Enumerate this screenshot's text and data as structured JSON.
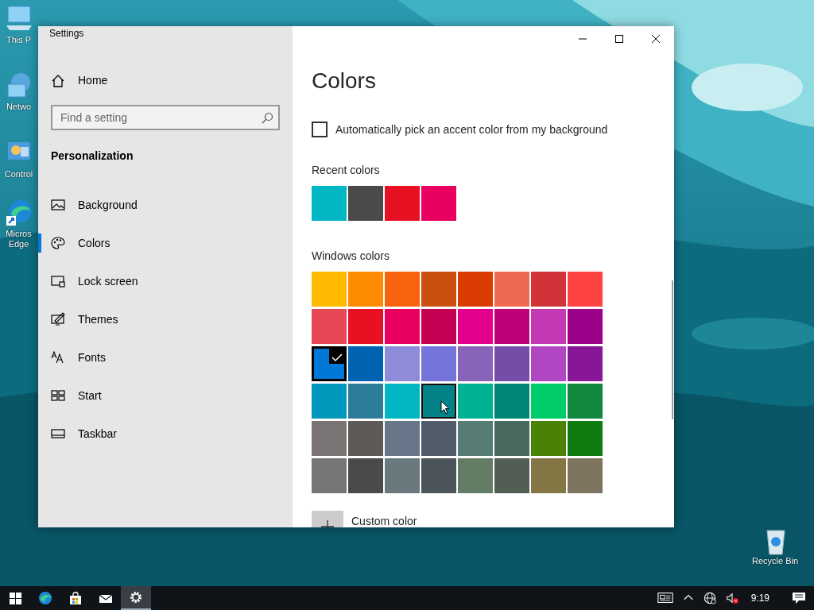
{
  "desktop_icons": [
    {
      "label": "This P"
    },
    {
      "label": "Netwo"
    },
    {
      "label": "Control"
    },
    {
      "label": "Micros Edge"
    },
    {
      "label": "Recycle Bin"
    }
  ],
  "window": {
    "title": "Settings",
    "sidebar": {
      "home": "Home",
      "search": {
        "placeholder": "Find a setting"
      },
      "section": "Personalization",
      "items": [
        {
          "label": "Background",
          "selected": false
        },
        {
          "label": "Colors",
          "selected": true
        },
        {
          "label": "Lock screen",
          "selected": false
        },
        {
          "label": "Themes",
          "selected": false
        },
        {
          "label": "Fonts",
          "selected": false
        },
        {
          "label": "Start",
          "selected": false
        },
        {
          "label": "Taskbar",
          "selected": false
        }
      ]
    },
    "content": {
      "heading": "Colors",
      "auto_accent": {
        "label": "Automatically pick an accent color from my background",
        "checked": false
      },
      "recent": {
        "label": "Recent colors",
        "swatches": [
          {
            "color": "#00b7c3"
          },
          {
            "color": "#4c4a48"
          },
          {
            "color": "#e81123"
          },
          {
            "color": "#ea005e"
          }
        ]
      },
      "windows": {
        "label": "Windows colors",
        "swatches": [
          {
            "color": "#ffb900",
            "selected": false,
            "hovered": false
          },
          {
            "color": "#ff8c00",
            "selected": false,
            "hovered": false
          },
          {
            "color": "#f7630c",
            "selected": false,
            "hovered": false
          },
          {
            "color": "#ca5010",
            "selected": false,
            "hovered": false
          },
          {
            "color": "#da3b01",
            "selected": false,
            "hovered": false
          },
          {
            "color": "#ef6950",
            "selected": false,
            "hovered": false
          },
          {
            "color": "#d13438",
            "selected": false,
            "hovered": false
          },
          {
            "color": "#ff4343",
            "selected": false,
            "hovered": false
          },
          {
            "color": "#e74856",
            "selected": false,
            "hovered": false
          },
          {
            "color": "#e81123",
            "selected": false,
            "hovered": false
          },
          {
            "color": "#ea005e",
            "selected": false,
            "hovered": false
          },
          {
            "color": "#c30052",
            "selected": false,
            "hovered": false
          },
          {
            "color": "#e3008c",
            "selected": false,
            "hovered": false
          },
          {
            "color": "#bf0077",
            "selected": false,
            "hovered": false
          },
          {
            "color": "#c239b3",
            "selected": false,
            "hovered": false
          },
          {
            "color": "#9a0089",
            "selected": false,
            "hovered": false
          },
          {
            "color": "#0078d7",
            "selected": true,
            "hovered": false
          },
          {
            "color": "#0063b1",
            "selected": false,
            "hovered": false
          },
          {
            "color": "#8e8cd8",
            "selected": false,
            "hovered": false
          },
          {
            "color": "#7474db",
            "selected": false,
            "hovered": false
          },
          {
            "color": "#8764b8",
            "selected": false,
            "hovered": false
          },
          {
            "color": "#744da9",
            "selected": false,
            "hovered": false
          },
          {
            "color": "#b146c2",
            "selected": false,
            "hovered": false
          },
          {
            "color": "#881798",
            "selected": false,
            "hovered": false
          },
          {
            "color": "#0099bc",
            "selected": false,
            "hovered": false
          },
          {
            "color": "#2d7d9a",
            "selected": false,
            "hovered": false
          },
          {
            "color": "#00b7c3",
            "selected": false,
            "hovered": false
          },
          {
            "color": "#038387",
            "selected": false,
            "hovered": true
          },
          {
            "color": "#00b294",
            "selected": false,
            "hovered": false
          },
          {
            "color": "#018574",
            "selected": false,
            "hovered": false
          },
          {
            "color": "#00cc6a",
            "selected": false,
            "hovered": false
          },
          {
            "color": "#10893e",
            "selected": false,
            "hovered": false
          },
          {
            "color": "#7a7574",
            "selected": false,
            "hovered": false
          },
          {
            "color": "#5d5a58",
            "selected": false,
            "hovered": false
          },
          {
            "color": "#68768a",
            "selected": false,
            "hovered": false
          },
          {
            "color": "#515c6b",
            "selected": false,
            "hovered": false
          },
          {
            "color": "#567c73",
            "selected": false,
            "hovered": false
          },
          {
            "color": "#486860",
            "selected": false,
            "hovered": false
          },
          {
            "color": "#498205",
            "selected": false,
            "hovered": false
          },
          {
            "color": "#107c10",
            "selected": false,
            "hovered": false
          },
          {
            "color": "#767676",
            "selected": false,
            "hovered": false
          },
          {
            "color": "#4c4a48",
            "selected": false,
            "hovered": false
          },
          {
            "color": "#69797e",
            "selected": false,
            "hovered": false
          },
          {
            "color": "#4a5459",
            "selected": false,
            "hovered": false
          },
          {
            "color": "#647c64",
            "selected": false,
            "hovered": false
          },
          {
            "color": "#525e54",
            "selected": false,
            "hovered": false
          },
          {
            "color": "#847545",
            "selected": false,
            "hovered": false
          },
          {
            "color": "#7e735f",
            "selected": false,
            "hovered": false
          }
        ]
      },
      "custom": {
        "label": "Custom color"
      }
    }
  },
  "taskbar": {
    "apps": [
      {
        "selected": false
      },
      {
        "selected": false
      },
      {
        "selected": false
      },
      {
        "selected": true
      }
    ],
    "time": "9:19"
  }
}
